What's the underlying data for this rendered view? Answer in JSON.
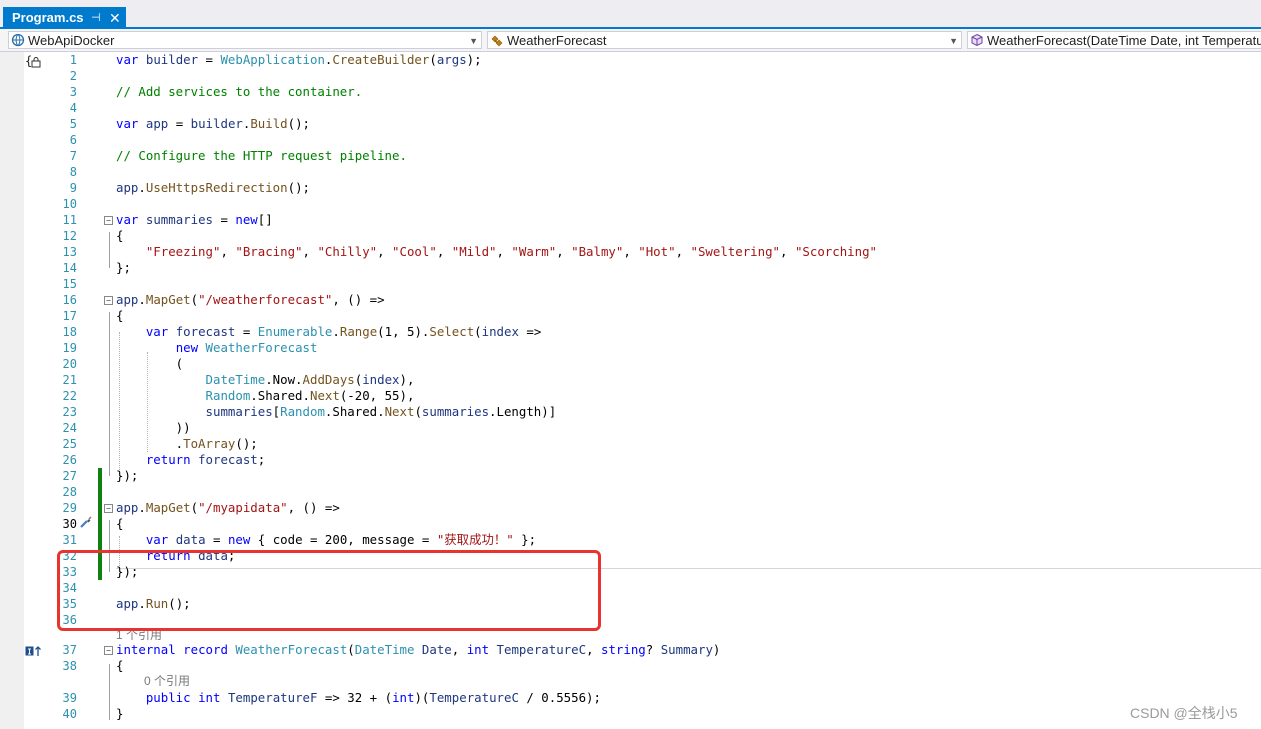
{
  "tab": {
    "title": "Program.cs",
    "pin_glyph": "⊣",
    "close_glyph": "✕"
  },
  "nav": {
    "project": {
      "label": "WebApiDocker",
      "icon": "csharp-project-icon"
    },
    "type": {
      "label": "WeatherForecast",
      "icon": "csharp-class-icon"
    },
    "member": {
      "label": "WeatherForecast(DateTime Date, int TemperatureC",
      "icon": "member-cube-icon"
    },
    "dropdown_glyph": "▼"
  },
  "lenses": {
    "ref1": "1 个引用",
    "ref0": "0 个引用"
  },
  "code_lines": [
    {
      "n": "1",
      "t": "var builder = WebApplication.CreateBuilder(args);"
    },
    {
      "n": "2",
      "t": ""
    },
    {
      "n": "3",
      "t": "// Add services to the container."
    },
    {
      "n": "4",
      "t": ""
    },
    {
      "n": "5",
      "t": "var app = builder.Build();"
    },
    {
      "n": "6",
      "t": ""
    },
    {
      "n": "7",
      "t": "// Configure the HTTP request pipeline."
    },
    {
      "n": "8",
      "t": ""
    },
    {
      "n": "9",
      "t": "app.UseHttpsRedirection();"
    },
    {
      "n": "10",
      "t": ""
    },
    {
      "n": "11",
      "t": "var summaries = new[]"
    },
    {
      "n": "12",
      "t": "{"
    },
    {
      "n": "13",
      "t": "    \"Freezing\", \"Bracing\", \"Chilly\", \"Cool\", \"Mild\", \"Warm\", \"Balmy\", \"Hot\", \"Sweltering\", \"Scorching\""
    },
    {
      "n": "14",
      "t": "};"
    },
    {
      "n": "15",
      "t": ""
    },
    {
      "n": "16",
      "t": "app.MapGet(\"/weatherforecast\", () =>"
    },
    {
      "n": "17",
      "t": "{"
    },
    {
      "n": "18",
      "t": "    var forecast = Enumerable.Range(1, 5).Select(index =>"
    },
    {
      "n": "19",
      "t": "        new WeatherForecast"
    },
    {
      "n": "20",
      "t": "        ("
    },
    {
      "n": "21",
      "t": "            DateTime.Now.AddDays(index),"
    },
    {
      "n": "22",
      "t": "            Random.Shared.Next(-20, 55),"
    },
    {
      "n": "23",
      "t": "            summaries[Random.Shared.Next(summaries.Length)]"
    },
    {
      "n": "24",
      "t": "        ))"
    },
    {
      "n": "25",
      "t": "        .ToArray();"
    },
    {
      "n": "26",
      "t": "    return forecast;"
    },
    {
      "n": "27",
      "t": "});"
    },
    {
      "n": "28",
      "t": ""
    },
    {
      "n": "29",
      "t": "app.MapGet(\"/myapidata\", () =>"
    },
    {
      "n": "30",
      "t": "{"
    },
    {
      "n": "31",
      "t": "    var data = new { code = 200, message = \"获取成功！\" };"
    },
    {
      "n": "32",
      "t": "    return data;"
    },
    {
      "n": "33",
      "t": "});"
    },
    {
      "n": "34",
      "t": ""
    },
    {
      "n": "35",
      "t": "app.Run();"
    },
    {
      "n": "36",
      "t": ""
    },
    {
      "n": "37",
      "t": "internal record WeatherForecast(DateTime Date, int TemperatureC, string? Summary)"
    },
    {
      "n": "38",
      "t": "{"
    },
    {
      "n": "39",
      "t": "    public int TemperatureF => 32 + (int)(TemperatureC / 0.5556);"
    },
    {
      "n": "40",
      "t": "}"
    }
  ],
  "watermark": "CSDN @全栈小5",
  "colors": {
    "accent": "#007acc",
    "change_bar": "#108010",
    "highlight_box": "#e8342f",
    "line_number": "#2b91af"
  }
}
